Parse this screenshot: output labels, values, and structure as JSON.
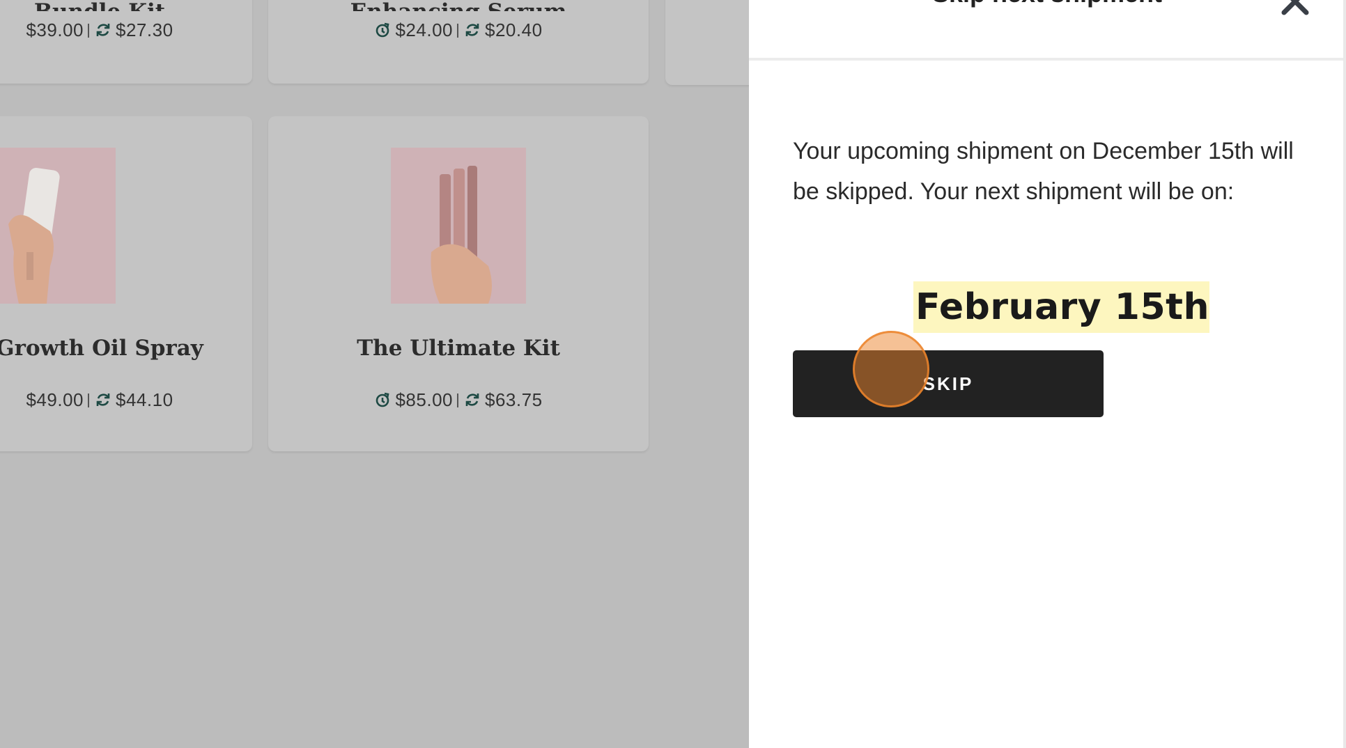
{
  "products_row_top": [
    {
      "title": "Bundle Kit",
      "price_regular": "$39.00",
      "price_subscription": "$27.30"
    },
    {
      "title": "Enhancing Serum",
      "price_regular": "$24.00",
      "price_subscription": "$20.40"
    }
  ],
  "products_row_bottom": [
    {
      "title": "Growth Oil Spray",
      "price_regular": "$49.00",
      "price_subscription": "$44.10"
    },
    {
      "title": "The Ultimate Kit",
      "price_regular": "$85.00",
      "price_subscription": "$63.75"
    }
  ],
  "drawer": {
    "title": "Skip next shipment",
    "message": "Your upcoming shipment on December 15th will be skipped. Your next shipment will be on:",
    "next_date": "February 15th",
    "skip_label": "SKIP",
    "close_icon": "close-icon"
  },
  "colors": {
    "overlay": "#bcbcbc",
    "button": "#222222",
    "highlight": "#fdf6bf",
    "click_marker": "#ec842c"
  }
}
